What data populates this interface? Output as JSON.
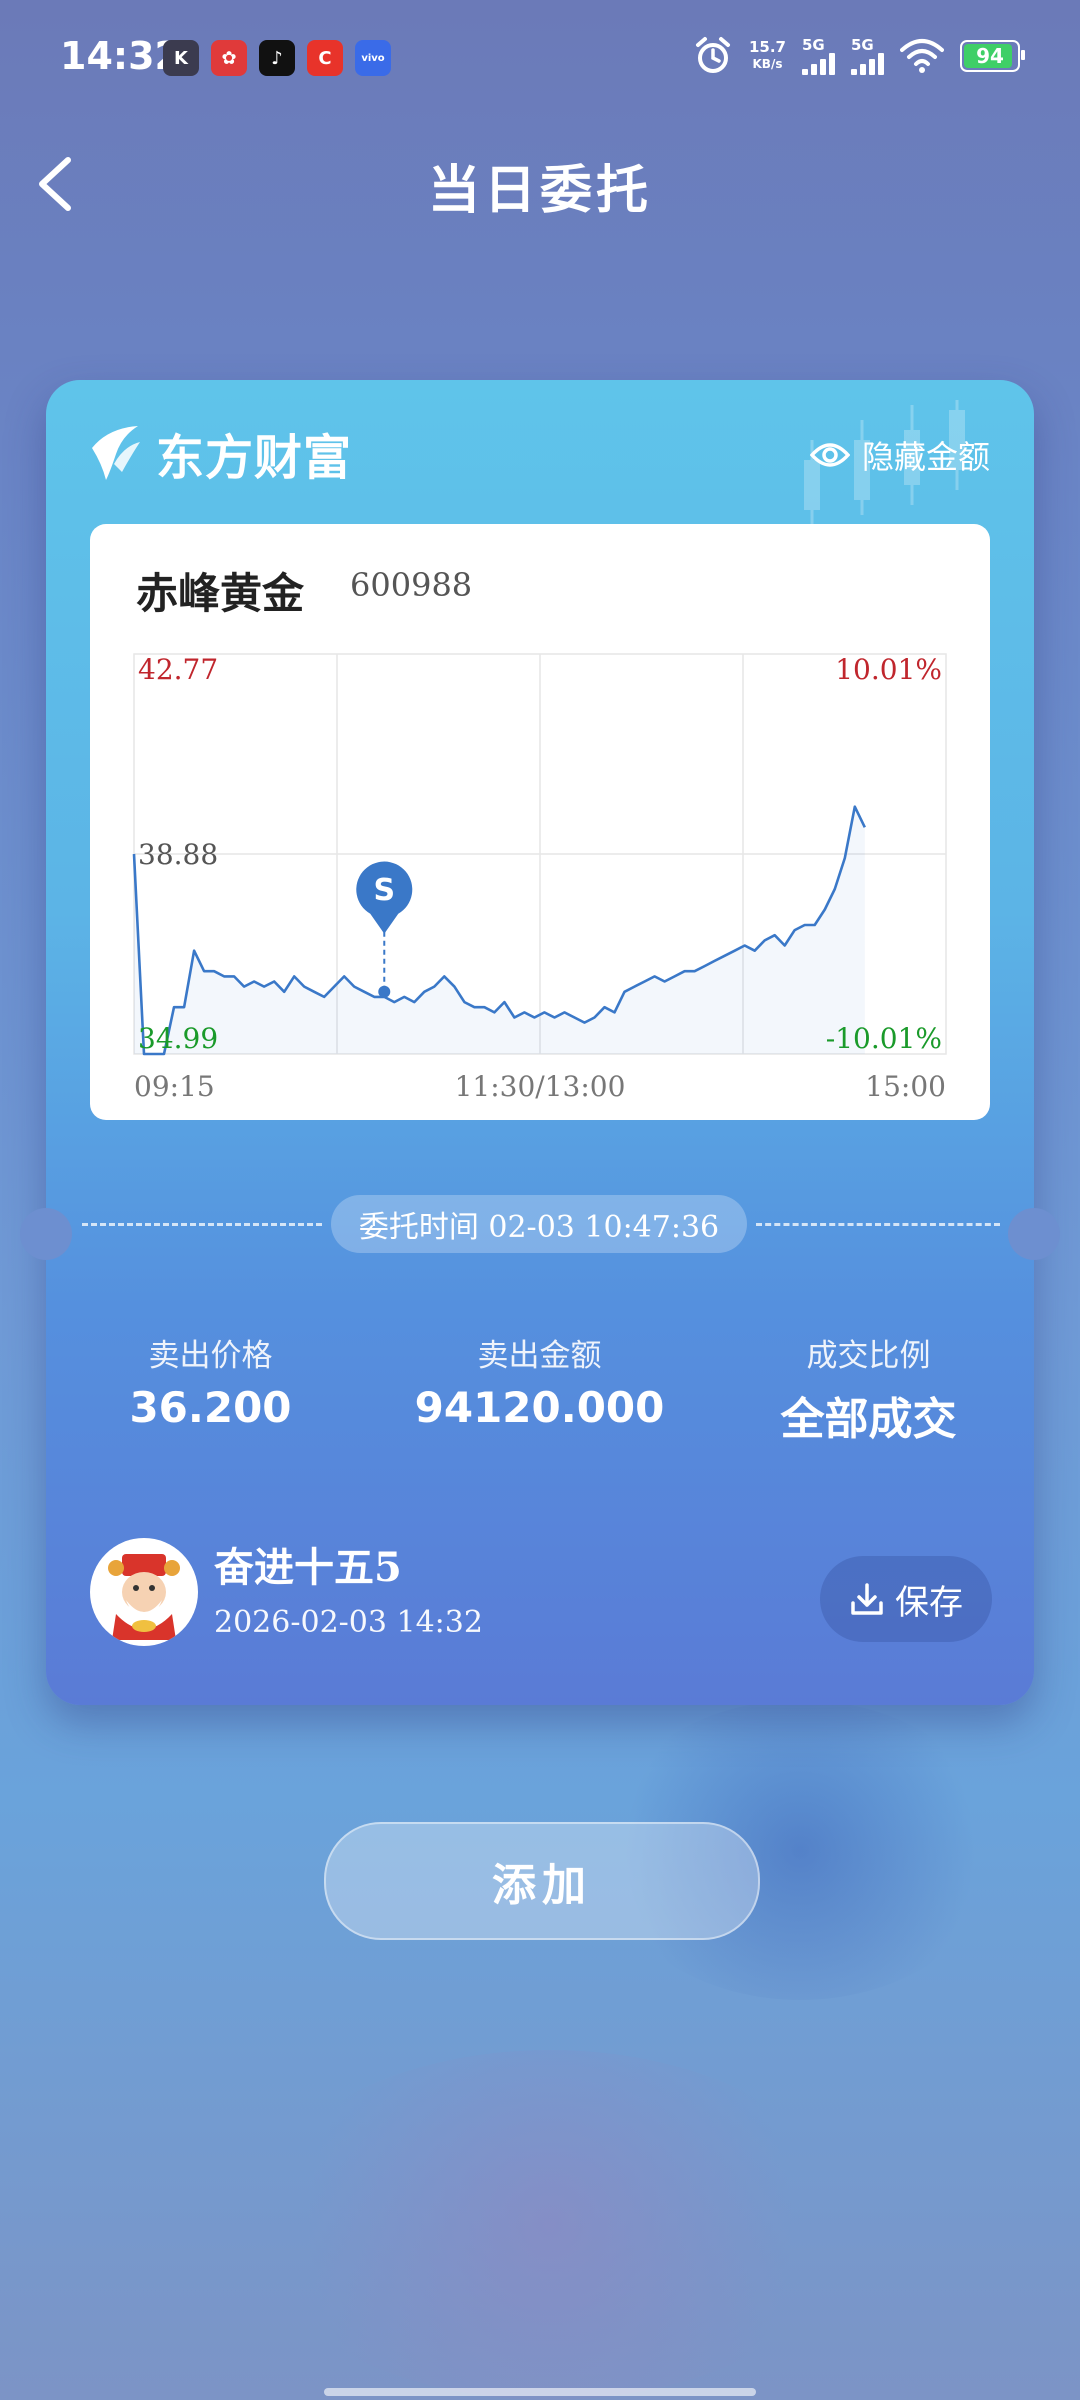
{
  "status": {
    "time": "14:32",
    "apps": [
      {
        "icon": "k-app-icon",
        "text": "K",
        "color": "#3b3b4f"
      },
      {
        "icon": "red-app-icon",
        "text": "✿",
        "color": "#e03a3a"
      },
      {
        "icon": "tiktok-icon",
        "text": "♪",
        "color": "#111111"
      },
      {
        "icon": "c-app-icon",
        "text": "C",
        "color": "#e8332a"
      },
      {
        "icon": "vivo-icon",
        "text": "vivo",
        "color": "#3a6be8"
      }
    ],
    "net_speed_value": "15.7",
    "net_speed_unit": "KB/s",
    "sim1": "5G",
    "sim2": "5G",
    "battery": "94"
  },
  "header": {
    "title": "当日委托"
  },
  "card": {
    "brand": "东方财富",
    "hide_amount_label": "隐藏金额",
    "stock_name": "赤峰黄金",
    "stock_code": "600988",
    "commission_time": "委托时间 02-03 10:47:36",
    "stats": [
      {
        "label": "卖出价格",
        "value": "36.200"
      },
      {
        "label": "卖出金额",
        "value": "94120.000"
      },
      {
        "label": "成交比例",
        "value": "全部成交"
      }
    ],
    "user_name": "奋进十五5",
    "user_date": "2026-02-03 14:32",
    "save_label": "保存"
  },
  "add_label": "添加",
  "chart_data": {
    "type": "line",
    "y_labels": {
      "top": "42.77",
      "mid": "38.88",
      "bottom": "34.99"
    },
    "pct_labels": {
      "top": "10.01%",
      "bottom": "-10.01%"
    },
    "x_labels": [
      "09:15",
      "11:30/13:00",
      "15:00"
    ],
    "ylim": [
      34.99,
      42.77
    ],
    "y": [
      38.88,
      34.99,
      34.99,
      34.99,
      35.9,
      35.9,
      37.0,
      36.6,
      36.6,
      36.5,
      36.5,
      36.3,
      36.4,
      36.3,
      36.4,
      36.2,
      36.5,
      36.3,
      36.2,
      36.1,
      36.3,
      36.5,
      36.3,
      36.2,
      36.1,
      36.1,
      36.0,
      36.1,
      36.0,
      36.2,
      36.3,
      36.5,
      36.3,
      36.0,
      35.9,
      35.9,
      35.8,
      36.0,
      35.7,
      35.8,
      35.7,
      35.8,
      35.7,
      35.8,
      35.7,
      35.6,
      35.7,
      35.9,
      35.8,
      36.2,
      36.3,
      36.4,
      36.5,
      36.4,
      36.5,
      36.6,
      36.6,
      36.7,
      36.8,
      36.9,
      37.0,
      37.1,
      37.0,
      37.2,
      37.3,
      37.1,
      37.4,
      37.5,
      37.5,
      37.8,
      38.2,
      38.8,
      39.8,
      39.4
    ],
    "sell_marker": {
      "label": "S",
      "time": "10:47",
      "price": 36.2
    },
    "colors": {
      "line": "#3a78c8",
      "up": "#c0262d",
      "down": "#1a9a2a"
    }
  }
}
